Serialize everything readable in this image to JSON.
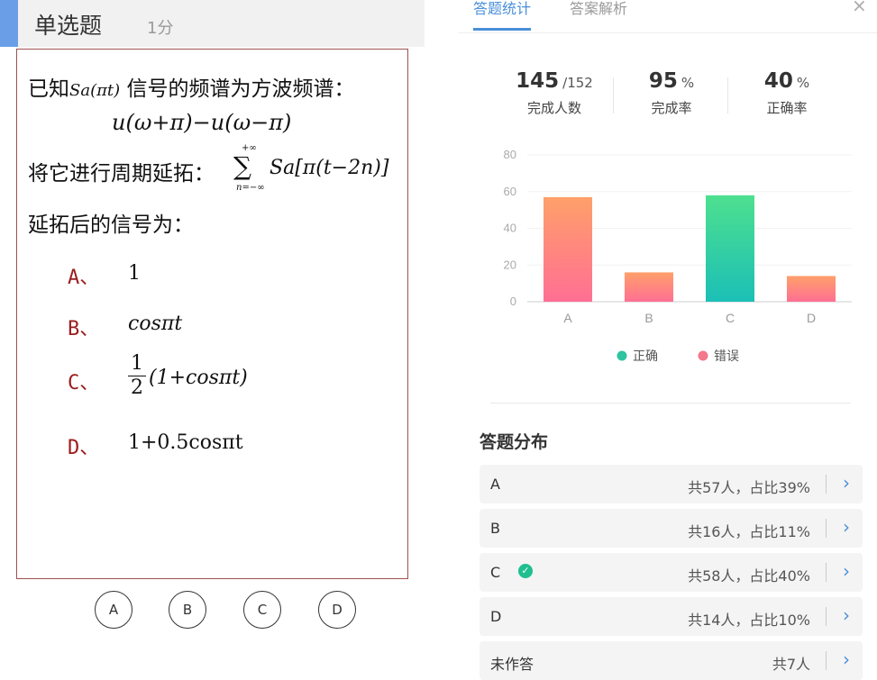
{
  "question": {
    "type": "单选题",
    "score": "1分",
    "intro_prefix": "已知",
    "intro_fn": "Sa(πt)",
    "intro_suffix": " 信号的频谱为方波频谱：",
    "spectrum": "u(ω+π)−u(ω−π)",
    "extend_prefix": "将它进行周期延拓：",
    "sum_upper": "+∞",
    "sum_lower": "n=−∞",
    "sum_symbol": "∑",
    "sum_body": "Sa[π(t−2n)]",
    "ask": "延拓后的信号为：",
    "options": [
      {
        "label": "A、",
        "value": "1"
      },
      {
        "label": "B、",
        "value": "cosπt"
      },
      {
        "label": "C、",
        "frac_num": "1",
        "frac_den": "2",
        "value_rest": "(1+cosπt)"
      },
      {
        "label": "D、",
        "value": "1+0.5cosπt"
      }
    ],
    "choice_buttons": [
      "A",
      "B",
      "C",
      "D"
    ]
  },
  "tabs": {
    "stats": "答题统计",
    "analysis": "答案解析",
    "close": "×"
  },
  "summary": {
    "done_count": "145",
    "total": "/152",
    "done_label": "完成人数",
    "completion": "95",
    "completion_unit": "%",
    "completion_label": "完成率",
    "accuracy": "40",
    "accuracy_unit": "%",
    "accuracy_label": "正确率"
  },
  "chart_data": {
    "type": "bar",
    "categories": [
      "A",
      "B",
      "C",
      "D"
    ],
    "values": [
      57,
      16,
      58,
      14
    ],
    "ylim": [
      0,
      80
    ],
    "yticks": [
      0,
      20,
      40,
      60,
      80
    ],
    "correct_index": 2,
    "legend": [
      {
        "name": "正确",
        "color": "#2ec4a0"
      },
      {
        "name": "错误",
        "color": "#f2788a"
      }
    ],
    "colors": {
      "correct_top": "#4ee08f",
      "correct_bottom": "#1bbfb6",
      "wrong_top": "#ffa06a",
      "wrong_bottom": "#ff6f93"
    }
  },
  "distribution": {
    "title": "答题分布",
    "rows": [
      {
        "option": "A",
        "count": "共57人，占比39%",
        "correct": false
      },
      {
        "option": "B",
        "count": "共16人，占比11%",
        "correct": false
      },
      {
        "option": "C",
        "count": "共58人，占比40%",
        "correct": true
      },
      {
        "option": "D",
        "count": "共14人，占比10%",
        "correct": false
      },
      {
        "option": "未作答",
        "count": "共7人",
        "correct": false
      }
    ]
  },
  "colors": {
    "accent": "#4a8fd9",
    "option_label": "#9b1c1c",
    "correct": "#1fbf8f"
  }
}
